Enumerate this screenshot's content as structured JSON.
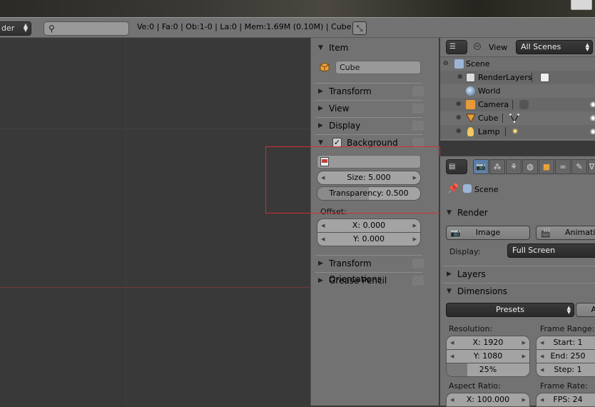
{
  "info_header": {
    "editor_label": "der",
    "stats": "Ve:0 | Fa:0 | Ob:1-0 | La:0 | Mem:1.69M (0.10M) | Cube"
  },
  "npanel": {
    "item": {
      "title": "Item",
      "object_name": "Cube"
    },
    "transform_title": "Transform",
    "view_title": "View",
    "display_title": "Display",
    "background_image": {
      "title": "Background Image",
      "size": "Size: 5.000",
      "transparency": "Transparency: 0.500",
      "transparency_fill_fraction": 0.5,
      "offset_label": "Offset:",
      "offset_x": "X: 0.000",
      "offset_y": "Y: 0.000"
    },
    "transform_orientations_title": "Transform Orientations",
    "grease_pencil_title": "Grease Pencil"
  },
  "outliner": {
    "view_label": "View",
    "scene_selector": "All Scenes",
    "items": [
      {
        "label": "Scene"
      },
      {
        "label": "RenderLayers"
      },
      {
        "label": "World"
      },
      {
        "label": "Camera"
      },
      {
        "label": "Cube"
      },
      {
        "label": "Lamp"
      }
    ]
  },
  "properties": {
    "context_label": "Scene",
    "render": {
      "title": "Render",
      "image_button": "Image",
      "animation_button": "Animation",
      "display_label": "Display:",
      "display_value": "Full Screen"
    },
    "layers_title": "Layers",
    "dimensions": {
      "title": "Dimensions",
      "presets": "Presets",
      "resolution_label": "Resolution:",
      "res_x": "X: 1920",
      "res_y": "Y: 1080",
      "res_percent": "25%",
      "res_percent_fill_fraction": 0.25,
      "frame_range_label": "Frame Range:",
      "start": "Start: 1",
      "end": "End: 250",
      "step": "Step: 1",
      "aspect_label": "Aspect Ratio:",
      "aspect_x": "X: 100.000",
      "frame_rate_label": "Frame Rate:",
      "fps": "FPS: 24"
    }
  }
}
